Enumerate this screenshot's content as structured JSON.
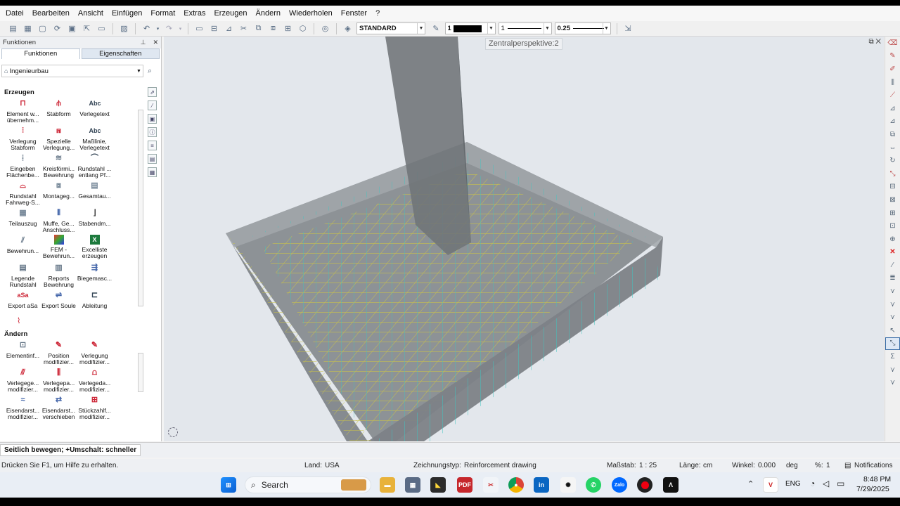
{
  "menu": [
    "Datei",
    "Bearbeiten",
    "Ansicht",
    "Einfügen",
    "Format",
    "Extras",
    "Erzeugen",
    "Ändern",
    "Wiederholen",
    "Fenster",
    "?"
  ],
  "toolbar": {
    "layer_label": "STANDARD",
    "pen_value": "1",
    "line_value": "1",
    "width_value": "0.25"
  },
  "panel": {
    "title": "Funktionen",
    "tabs": [
      "Funktionen",
      "Eigenschaften"
    ],
    "category": "Ingenieurbau",
    "section_create": "Erzeugen",
    "section_modify": "Ändern",
    "create_tools": [
      {
        "label": "Element w... übernehm..."
      },
      {
        "label": "Stabform"
      },
      {
        "label": "Verlegetext"
      },
      {
        "label": "Verlegung Stabform"
      },
      {
        "label": "Spezielle Verlegung..."
      },
      {
        "label": "Maßlinie, Verlegetext"
      },
      {
        "label": "Eingeben Flächenbe..."
      },
      {
        "label": "Kreisförmi... Bewehrung"
      },
      {
        "label": "Rundstahl ... entlang Pf..."
      },
      {
        "label": "Rundstahl Fahrweg-S..."
      },
      {
        "label": "Montageg..."
      },
      {
        "label": "Gesamtau..."
      },
      {
        "label": "Teilauszug"
      },
      {
        "label": "Muffe, Ge... Anschluss..."
      },
      {
        "label": "Stabendm..."
      },
      {
        "label": "Bewehrun..."
      },
      {
        "label": "FEM - Bewehrun..."
      },
      {
        "label": "Excelliste erzeugen"
      },
      {
        "label": "Legende Rundstahl"
      },
      {
        "label": "Reports Bewehrung"
      },
      {
        "label": "Biegemasc..."
      },
      {
        "label": "Export aSa"
      },
      {
        "label": "Export Soule"
      },
      {
        "label": "Ableitung"
      }
    ],
    "modify_tools": [
      {
        "label": "Elementinf..."
      },
      {
        "label": "Position modifizier..."
      },
      {
        "label": "Verlegung modifizier..."
      },
      {
        "label": "Verlegege... modifizier..."
      },
      {
        "label": "Verlegepa... modifizier..."
      },
      {
        "label": "Verlegeda... modifizier..."
      },
      {
        "label": "Eisendarst... modifizier..."
      },
      {
        "label": "Eisendarst... verschieben"
      },
      {
        "label": "Stückzahlf... modifizier..."
      }
    ]
  },
  "viewport": {
    "title": "Zentralperspektive:2"
  },
  "hint": "Seitlich bewegen; +Umschalt: schneller",
  "status": {
    "help": "Drücken Sie F1, um Hilfe zu erhalten.",
    "country_label": "Land:",
    "country": "USA",
    "drawing_type_label": "Zeichnungstyp:",
    "drawing_type": "Reinforcement drawing",
    "scale_label": "Maßstab:",
    "scale": "1 : 25",
    "length_label": "Länge:",
    "length_unit": "cm",
    "angle_label": "Winkel:",
    "angle": "0.000",
    "angle_unit": "deg",
    "percent_label": "%:",
    "percent": "1",
    "notifications": "Notifications"
  },
  "taskbar": {
    "search_placeholder": "Search",
    "lang": "ENG",
    "time": "8:48 PM",
    "date": "7/29/2025"
  }
}
